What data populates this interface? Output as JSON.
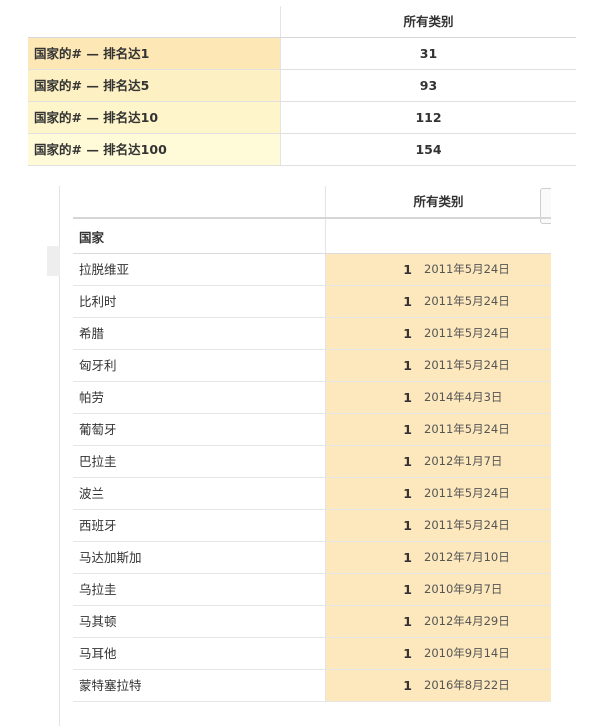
{
  "summary": {
    "column_header": "所有类别",
    "rows": [
      {
        "label": "国家的# — 排名达1",
        "value": "31"
      },
      {
        "label": "国家的# — 排名达5",
        "value": "93"
      },
      {
        "label": "国家的# — 排名达10",
        "value": "112"
      },
      {
        "label": "国家的# — 排名达100",
        "value": "154"
      }
    ]
  },
  "detail": {
    "column_header": "所有类别",
    "row_header": "国家",
    "rows": [
      {
        "country": "拉脱维亚",
        "rank": "1",
        "date": "2011年5月24日"
      },
      {
        "country": "比利时",
        "rank": "1",
        "date": "2011年5月24日"
      },
      {
        "country": "希腊",
        "rank": "1",
        "date": "2011年5月24日"
      },
      {
        "country": "匈牙利",
        "rank": "1",
        "date": "2011年5月24日"
      },
      {
        "country": "帕劳",
        "rank": "1",
        "date": "2014年4月3日"
      },
      {
        "country": "葡萄牙",
        "rank": "1",
        "date": "2011年5月24日"
      },
      {
        "country": "巴拉圭",
        "rank": "1",
        "date": "2012年1月7日"
      },
      {
        "country": "波兰",
        "rank": "1",
        "date": "2011年5月24日"
      },
      {
        "country": "西班牙",
        "rank": "1",
        "date": "2011年5月24日"
      },
      {
        "country": "马达加斯加",
        "rank": "1",
        "date": "2012年7月10日"
      },
      {
        "country": "乌拉圭",
        "rank": "1",
        "date": "2010年9月7日"
      },
      {
        "country": "马其顿",
        "rank": "1",
        "date": "2012年4月29日"
      },
      {
        "country": "马耳他",
        "rank": "1",
        "date": "2010年9月14日"
      },
      {
        "country": "蒙特塞拉特",
        "rank": "1",
        "date": "2016年8月22日"
      }
    ]
  },
  "colors": {
    "highlight": "#fde8bd",
    "rank1_label": "#fde7b5",
    "rank100_label": "#fffbd9"
  }
}
